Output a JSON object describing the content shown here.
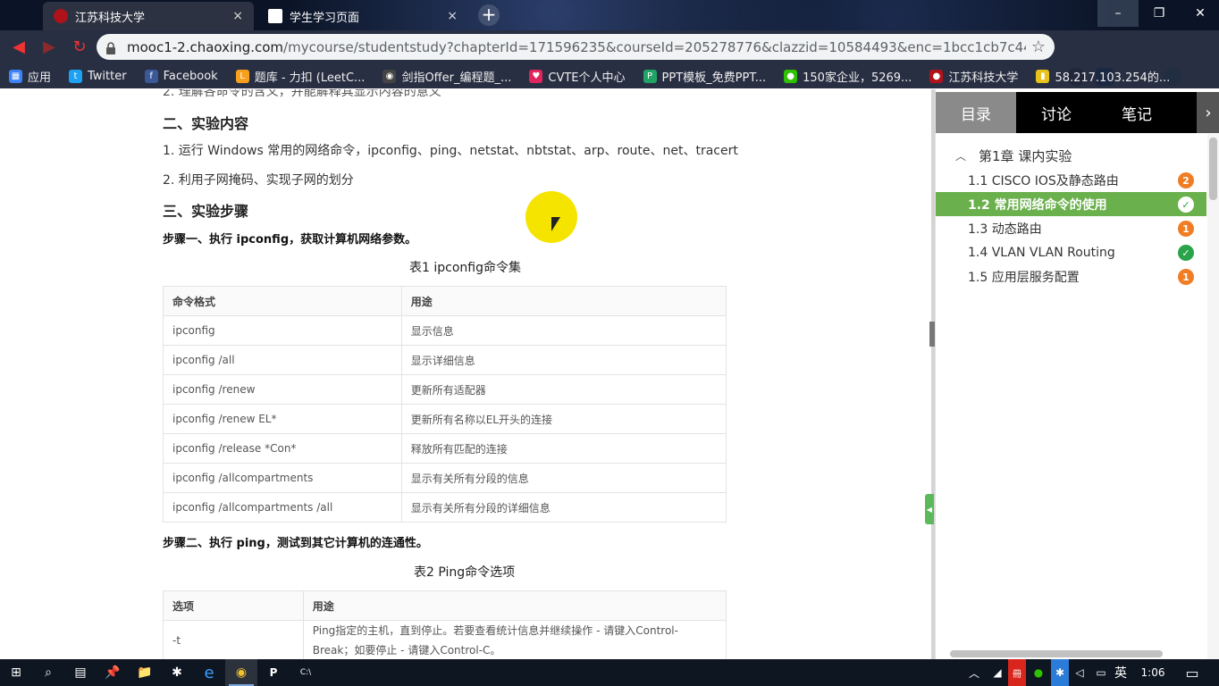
{
  "browser": {
    "tabs": [
      {
        "title": "江苏科技大学",
        "favicon_color": "#b0121b",
        "active": true
      },
      {
        "title": "学生学习页面",
        "favicon_color": "#ffffff",
        "active": false
      }
    ],
    "new_tab_label": "+",
    "close_glyph": "×",
    "window": {
      "minimize": "–",
      "restore": "❐",
      "close": "✕"
    },
    "url": {
      "host": "mooc1-2.chaoxing.com",
      "path": "/mycourse/studentstudy?chapterId=171596235&courseId=205278776&clazzid=10584493&enc=1bcc1cb7c44c48f38fe77ac..."
    },
    "bookmarks": [
      {
        "label": "应用",
        "icon": "apps-icon",
        "color": "#3b82f6",
        "glyph": "▦"
      },
      {
        "label": "Twitter",
        "icon": "twitter-icon",
        "color": "#1da1f2",
        "glyph": "t"
      },
      {
        "label": "Facebook",
        "icon": "facebook-icon",
        "color": "#3b5998",
        "glyph": "f"
      },
      {
        "label": "题库 - 力扣 (LeetC...",
        "icon": "leetcode-icon",
        "color": "#f89f1b",
        "glyph": "L"
      },
      {
        "label": "剑指Offer_编程题_...",
        "icon": "nowcoder-icon",
        "color": "#444444",
        "glyph": "◉"
      },
      {
        "label": "CVTE个人中心",
        "icon": "cvte-icon",
        "color": "#e0245e",
        "glyph": "♥"
      },
      {
        "label": "PPT模板_免费PPT...",
        "icon": "ppt-icon",
        "color": "#21a366",
        "glyph": "P"
      },
      {
        "label": "150家企业，5269...",
        "icon": "wechat-icon",
        "color": "#2dc100",
        "glyph": "●"
      },
      {
        "label": "江苏科技大学",
        "icon": "university-icon",
        "color": "#b0121b",
        "glyph": "●"
      },
      {
        "label": "58.217.103.254的...",
        "icon": "page-icon",
        "color": "#e8c21a",
        "glyph": "▮"
      }
    ]
  },
  "content": {
    "cut_line": "2. 理解各命令的含义，并能解释其显示内容的意义",
    "section2_title": "二、实验内容",
    "item1": "1. 运行 Windows 常用的网络命令，ipconfig、ping、netstat、nbtstat、arp、route、net、tracert",
    "item2": "2. 利用子网掩码、实现子网的划分",
    "section3_title": "三、实验步骤",
    "step1": "步骤一、执行 ipconfig，获取计算机网络参数。",
    "table1_caption": "表1 ipconfig命令集",
    "table1": {
      "headers": [
        "命令格式",
        "用途"
      ],
      "rows": [
        [
          "ipconfig",
          "显示信息"
        ],
        [
          "ipconfig /all",
          "显示详细信息"
        ],
        [
          "ipconfig /renew",
          "更新所有适配器"
        ],
        [
          "ipconfig /renew EL*",
          "更新所有名称以EL开头的连接"
        ],
        [
          "ipconfig /release *Con*",
          "释放所有匹配的连接"
        ],
        [
          "ipconfig /allcompartments",
          "显示有关所有分段的信息"
        ],
        [
          "ipconfig /allcompartments /all",
          "显示有关所有分段的详细信息"
        ]
      ]
    },
    "step2": "步骤二、执行 ping，测试到其它计算机的连通性。",
    "table2_caption": "表2 Ping命令选项",
    "table2": {
      "headers": [
        "选项",
        "用途"
      ],
      "rows": [
        [
          "-t",
          "Ping指定的主机，直到停止。若要查看统计信息并继续操作 - 请键入Control-Break；如要停止 - 请键入Control-C。"
        ]
      ]
    }
  },
  "sidebar": {
    "tabs": [
      "目录",
      "讨论",
      "笔记"
    ],
    "more_arrow": "›",
    "chapter": "第1章 课内实验",
    "lessons": [
      {
        "label": "1.1 CISCO IOS及静态路由",
        "badge": "2",
        "status": "pending",
        "active": false
      },
      {
        "label": "1.2 常用网络命令的使用",
        "badge": "✓",
        "status": "done",
        "active": true
      },
      {
        "label": "1.3 动态路由",
        "badge": "1",
        "status": "pending",
        "active": false
      },
      {
        "label": "1.4 VLAN VLAN Routing",
        "badge": "✓",
        "status": "done",
        "active": false
      },
      {
        "label": "1.5 应用层服务配置",
        "badge": "1",
        "status": "pending",
        "active": false
      }
    ]
  },
  "taskbar": {
    "apps": [
      {
        "name": "start-button",
        "glyph": "⊞"
      },
      {
        "name": "search-icon",
        "glyph": "⌕"
      },
      {
        "name": "calculator-icon",
        "glyph": "▤"
      },
      {
        "name": "pin-icon",
        "glyph": "📌"
      },
      {
        "name": "file-explorer-icon",
        "glyph": "📁"
      },
      {
        "name": "star-app-icon",
        "glyph": "✱"
      },
      {
        "name": "edge-icon",
        "glyph": "e"
      },
      {
        "name": "chrome-icon",
        "glyph": "◉"
      },
      {
        "name": "powerpoint-icon",
        "glyph": "P"
      },
      {
        "name": "terminal-icon",
        "glyph": "C:\\"
      }
    ],
    "tray": {
      "ime_lang": "英",
      "clock": "1:06",
      "notification_glyph": "▭"
    }
  }
}
